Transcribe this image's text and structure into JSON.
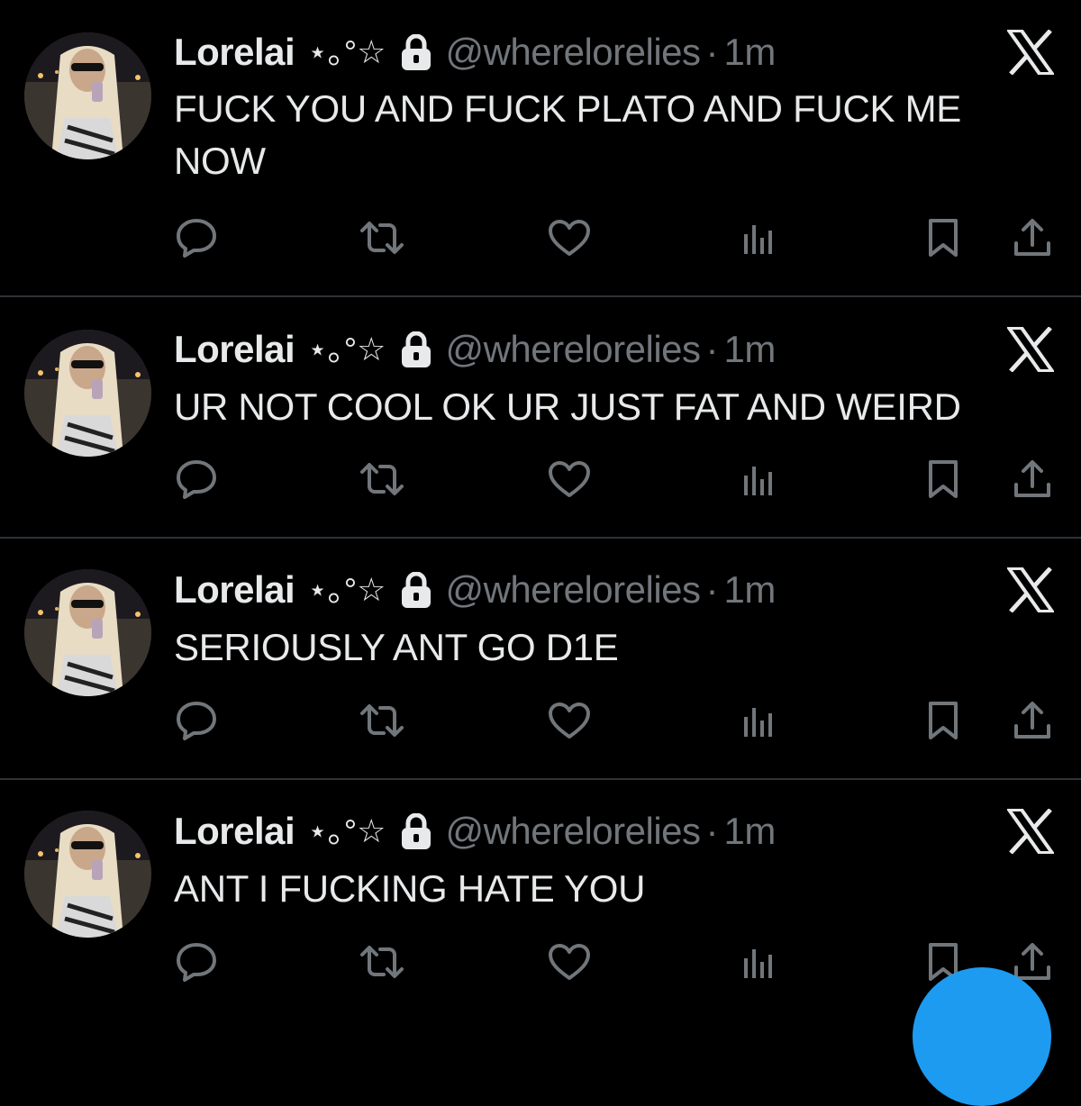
{
  "tweets": [
    {
      "display_name": "Lorelai",
      "name_decoration": "⋆｡°☆",
      "handle": "@wherelorelies",
      "separator": "·",
      "time": "1m",
      "text": "FUCK YOU AND FUCK PLATO AND FUCK ME NOW"
    },
    {
      "display_name": "Lorelai",
      "name_decoration": "⋆｡°☆",
      "handle": "@wherelorelies",
      "separator": "·",
      "time": "1m",
      "text": "UR NOT COOL OK UR JUST FAT AND WEIRD"
    },
    {
      "display_name": "Lorelai",
      "name_decoration": "⋆｡°☆",
      "handle": "@wherelorelies",
      "separator": "·",
      "time": "1m",
      "text": "SERIOUSLY ANT GO D1E"
    },
    {
      "display_name": "Lorelai",
      "name_decoration": "⋆｡°☆",
      "handle": "@wherelorelies",
      "separator": "·",
      "time": "1m",
      "text": "ANT I FUCKING HATE YOU"
    }
  ],
  "icons": {
    "lock": "lock-icon",
    "brand": "x-logo-icon",
    "reply": "reply-icon",
    "repost": "repost-icon",
    "like": "like-icon",
    "views": "views-icon",
    "bookmark": "bookmark-icon",
    "share": "share-icon"
  },
  "colors": {
    "background": "#000000",
    "text_primary": "#e7e9ea",
    "text_secondary": "#71767b",
    "divider": "#2f3336",
    "fab_accent": "#1d9bf0"
  }
}
